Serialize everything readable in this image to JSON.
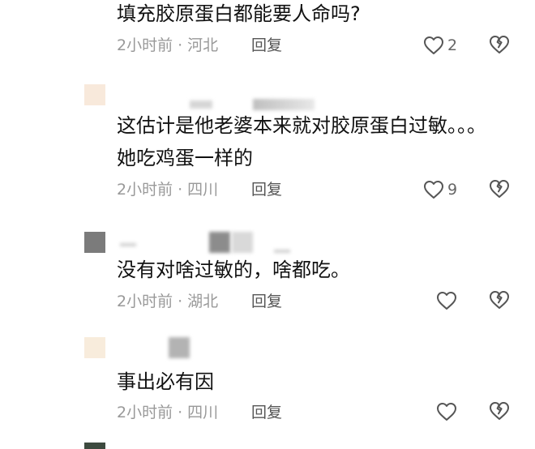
{
  "comments": [
    {
      "text_lines": [
        "填充胶原蛋白都能要人命吗?"
      ],
      "time": "2小时前",
      "location": "河北",
      "reply_label": "回复",
      "likes": "2"
    },
    {
      "text_lines": [
        "这估计是他老婆本来就对胶原蛋白过敏。。。",
        "她吃鸡蛋一样的"
      ],
      "time": "2小时前",
      "location": "四川",
      "reply_label": "回复",
      "likes": "9"
    },
    {
      "text_lines": [
        "没有对啥过敏的，啥都吃。"
      ],
      "time": "2小时前",
      "location": "湖北",
      "reply_label": "回复",
      "likes": ""
    },
    {
      "text_lines": [
        "事出必有因"
      ],
      "time": "2小时前",
      "location": "四川",
      "reply_label": "回复",
      "likes": ""
    }
  ],
  "separator": "·",
  "icons": {
    "like": "heart-outline-icon",
    "dislike": "broken-heart-icon"
  },
  "colors": {
    "text": "#111111",
    "meta": "#999999",
    "icon": "#555555"
  }
}
